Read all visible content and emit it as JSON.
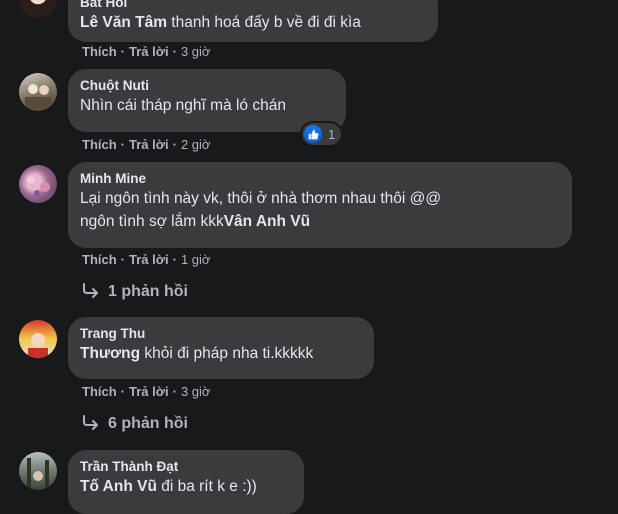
{
  "comments": [
    {
      "author": "Bất Hối",
      "mention": "Lê Văn Tâm",
      "text": " thanh hoá đấy b về đi đi kìa",
      "like_label": "Thích",
      "reply_label": "Trả lời",
      "time": "3 giờ"
    },
    {
      "author": "Chuột Nuti",
      "text": "Nhìn cái tháp nghĩ mà ló chán",
      "like_label": "Thích",
      "reply_label": "Trả lời",
      "time": "2 giờ",
      "reaction_count": "1"
    },
    {
      "author": "Minh Mine",
      "line1": "Lại ngôn tình này vk, thôi ở nhà thơm nhau thôi @@",
      "line2": "ngôn tình sợ lắm kkk",
      "mention": "Vân Anh Vũ",
      "like_label": "Thích",
      "reply_label": "Trả lời",
      "time": "1 giờ",
      "replies_label": "1 phản hồi"
    },
    {
      "author": "Trang Thu",
      "mention": "Thương",
      "text": " khỏi đi pháp nha ti.kkkkk",
      "like_label": "Thích",
      "reply_label": "Trả lời",
      "time": "3 giờ",
      "replies_label": "6 phản hồi"
    },
    {
      "author": "Trần Thành Đạt",
      "mention": "Tố Anh Vũ",
      "text": " đi ba rít k e :))"
    }
  ],
  "separator": "·",
  "colors": {
    "background": "#18191a",
    "bubble": "#3a3b3c",
    "primary_text": "#e4e6eb",
    "secondary_text": "#b0b3b8",
    "like_blue": "#1877f2"
  }
}
